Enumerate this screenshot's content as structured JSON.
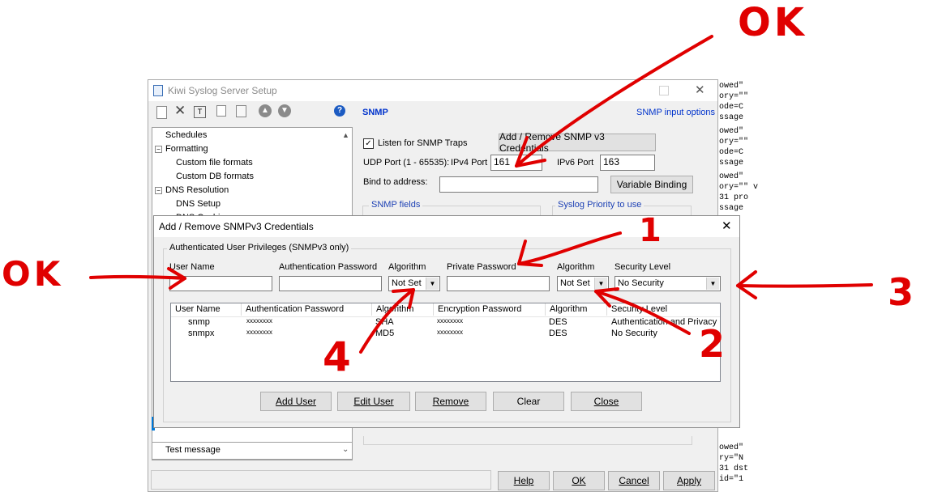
{
  "bg_log": [
    "owed\"",
    "ory=\"\"",
    "ode=C",
    "ssage",
    "owed\"",
    "ory=\"\"",
    "ode=C",
    "ssage",
    "owed\"",
    "ory=\"\" v",
    "31 pro",
    "ssage",
    "owed\"",
    "ry=\"N",
    "31 dst",
    "id=\"1"
  ],
  "setup": {
    "title": "Kiwi Syslog Server Setup",
    "section_title": "SNMP",
    "section_hint": "SNMP input options",
    "tree": [
      "Schedules",
      "Formatting",
      "Custom file formats",
      "Custom DB formats",
      "DNS Resolution",
      "DNS Setup",
      "DNS Caching"
    ],
    "tree_bottom": "Test message",
    "listen_label": "Listen for SNMP Traps",
    "v3_button": "Add / Remove SNMP v3 Credentials",
    "udp_label": "UDP Port (1 - 65535):",
    "ipv4_label": "IPv4 Port",
    "ipv4_value": "161",
    "ipv6_label": "IPv6 Port",
    "ipv6_value": "163",
    "bind_label": "Bind to address:",
    "bind_value": "",
    "variable_binding": "Variable Binding",
    "snmp_fields": "SNMP fields",
    "syslog_priority": "Syslog Priority to use",
    "buttons": {
      "help": "Help",
      "ok": "OK",
      "cancel": "Cancel",
      "apply": "Apply"
    }
  },
  "dialog": {
    "title": "Add / Remove SNMPv3 Credentials",
    "group_label": "Authenticated User Privileges (SNMPv3 only)",
    "labels": {
      "user_name": "User Name",
      "auth_password": "Authentication Password",
      "algorithm1": "Algorithm",
      "private_password": "Private Password",
      "algorithm2": "Algorithm",
      "security_level": "Security Level"
    },
    "inputs": {
      "user_name": "",
      "auth_password": "",
      "algorithm1": "Not Set",
      "private_password": "",
      "algorithm2": "Not Set",
      "security_level": "No Security"
    },
    "columns": [
      "User Name",
      "Authentication Password",
      "Algorithm",
      "Encryption Password",
      "Algorithm",
      "Security Level"
    ],
    "rows": [
      {
        "user": "snmp",
        "auth": "xxxxxxxx",
        "alg1": "SHA",
        "enc": "xxxxxxxx",
        "alg2": "DES",
        "level": "Authentication and Privacy"
      },
      {
        "user": "snmpx",
        "auth": "xxxxxxxx",
        "alg1": "MD5",
        "enc": "xxxxxxxx",
        "alg2": "DES",
        "level": "No Security"
      }
    ],
    "buttons": {
      "add": "Add User",
      "edit": "Edit User",
      "remove": "Remove",
      "clear": "Clear",
      "close": "Close"
    }
  },
  "annotations": {
    "ok_top": "OK",
    "ok_left": "OK",
    "n1": "1",
    "n2": "2",
    "n3": "3",
    "n4": "4"
  },
  "colors": {
    "annotation": "#e00000",
    "section_blue": "#0033cc",
    "link_blue": "#1c40b4"
  }
}
